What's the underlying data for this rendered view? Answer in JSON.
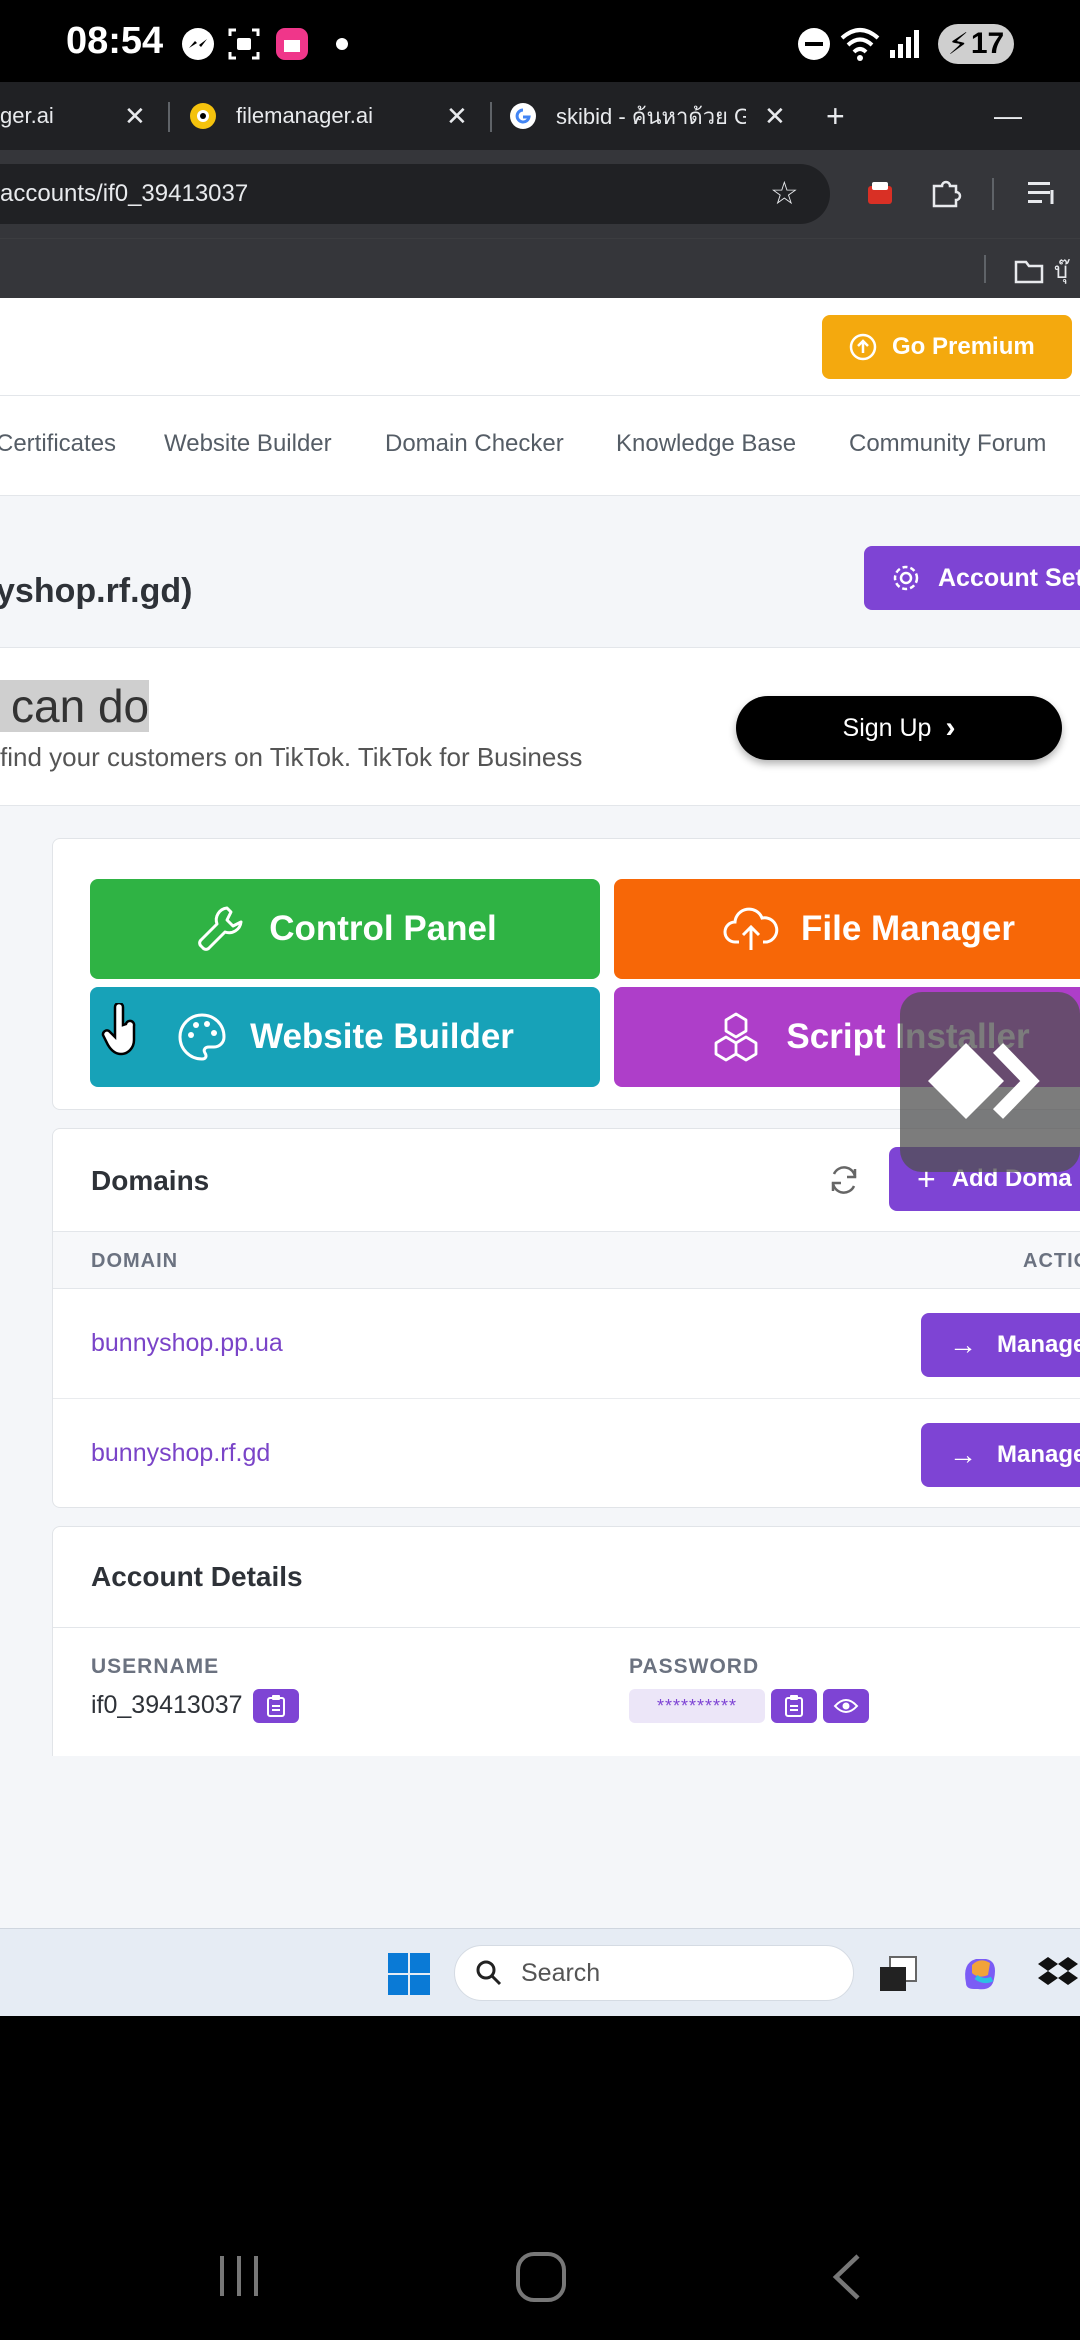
{
  "status_bar": {
    "time": "08:54",
    "battery": "17"
  },
  "browser": {
    "tabs": [
      {
        "label": "ger.ai"
      },
      {
        "label": "filemanager.ai"
      },
      {
        "label": "skibid - ค้นหาด้วย Go"
      }
    ],
    "address": "accounts/if0_39413037",
    "bookmark_folder": "บุ๊"
  },
  "page": {
    "premium_label": "Go Premium",
    "menu": [
      "Certificates",
      "Website Builder",
      "Domain Checker",
      "Knowledge Base",
      "Community Forum"
    ],
    "account_title": "yshop.rf.gd)",
    "account_settings_label": "Account Set",
    "ad": {
      "title": "l can do",
      "subtitle": "find your customers on TikTok. TikTok for Business",
      "button": "Sign Up"
    },
    "tools": {
      "control_panel": "Control Panel",
      "file_manager": "File Manager",
      "website_builder": "Website Builder",
      "script_installer": "Script Installer"
    },
    "domains": {
      "title": "Domains",
      "add_label": "Add Doma",
      "col_domain": "DOMAIN",
      "col_action": "ACTIO",
      "rows": [
        {
          "domain": "bunnyshop.pp.ua",
          "action": "Manage"
        },
        {
          "domain": "bunnyshop.rf.gd",
          "action": "Manage"
        }
      ]
    },
    "details": {
      "title": "Account Details",
      "username_label": "USERNAME",
      "username": "if0_39413037",
      "password_label": "PASSWORD",
      "password_masked": "**********"
    }
  },
  "taskbar": {
    "search_placeholder": "Search"
  },
  "colors": {
    "accent_purple": "#7e44d4",
    "premium_orange": "#f4a90e",
    "control_green": "#2fb344",
    "file_orange": "#f76707",
    "builder_teal": "#17a2b8",
    "script_purple": "#ae3ec9"
  }
}
